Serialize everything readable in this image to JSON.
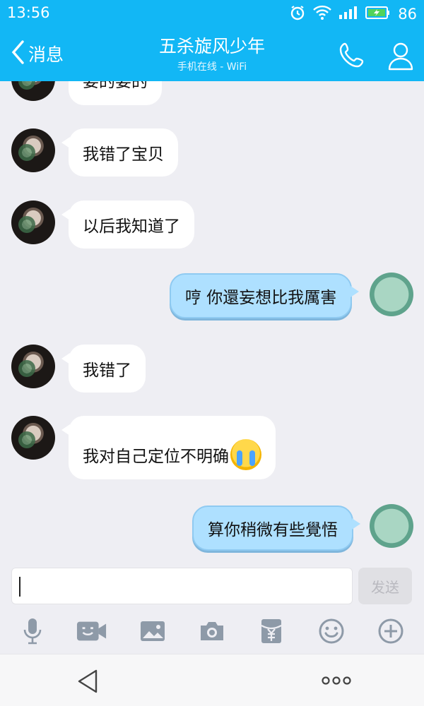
{
  "status_bar": {
    "time": "13:56",
    "battery": "86"
  },
  "header": {
    "back_label": "消息",
    "title": "五杀旋风少年",
    "subtitle": "手机在线 - WiFi"
  },
  "messages": [
    {
      "side": "in",
      "text": "要的要的",
      "partial": true
    },
    {
      "side": "in",
      "text": "我错了宝贝"
    },
    {
      "side": "in",
      "text": "以后我知道了"
    },
    {
      "side": "out",
      "text": "哼 你還妄想比我厲害"
    },
    {
      "side": "in",
      "text": "我错了"
    },
    {
      "side": "in",
      "text": "我对自己定位不明确",
      "emoji": "crying-face"
    },
    {
      "side": "out",
      "text": "算你稍微有些覺悟"
    }
  ],
  "input": {
    "value": "",
    "send_label": "发送"
  },
  "toolbar": [
    "microphone-icon",
    "video-call-icon",
    "image-icon",
    "camera-icon",
    "red-packet-icon",
    "emoji-icon",
    "plus-icon"
  ],
  "colors": {
    "accent": "#12b7f5",
    "out_bubble": "#aee0ff",
    "background": "#eeeef3"
  }
}
